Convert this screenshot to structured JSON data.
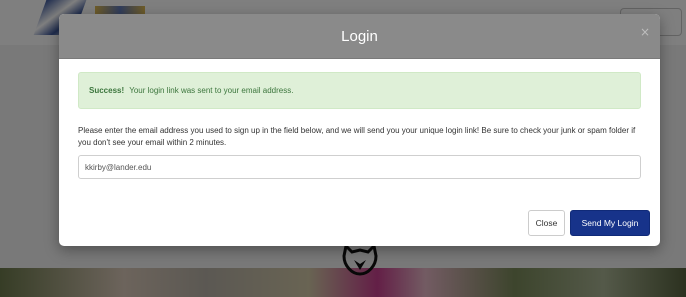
{
  "modal": {
    "title": "Login",
    "close_glyph": "×",
    "alert": {
      "strong": "Success!",
      "message": "Your login link was sent to your email address."
    },
    "instructions": "Please enter the email address you used to sign up in the field below, and we will send you your unique login link! Be sure to check your junk or spam folder if you don't see your email within 2 minutes.",
    "email_value": "kkirby@lander.edu",
    "buttons": {
      "close_label": "Close",
      "send_label": "Send My Login"
    }
  },
  "colors": {
    "header_bg": "#8a8a8a",
    "alert_bg": "#dff0d8",
    "alert_text": "#3c763d",
    "primary_button": "#17338a"
  },
  "icons": [
    "close-icon",
    "school-logo",
    "mascot-icon"
  ]
}
